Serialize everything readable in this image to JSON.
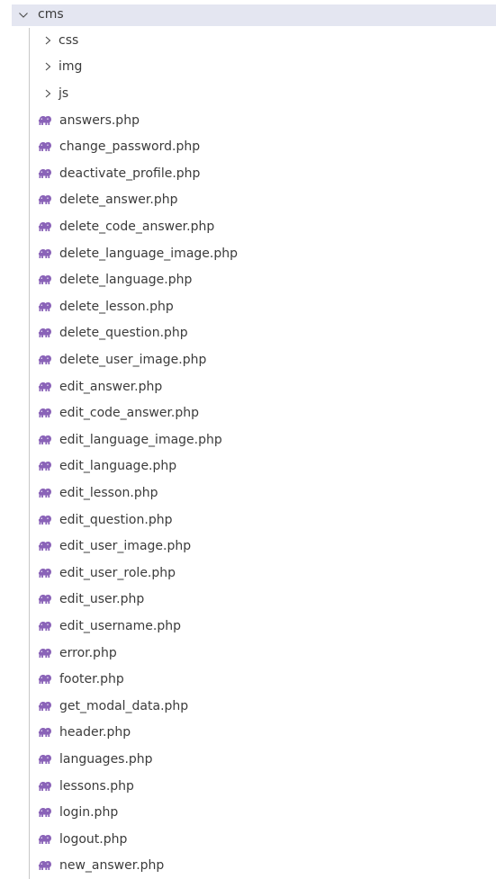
{
  "explorer": {
    "root": {
      "label": "cms",
      "icon": "chevron-down-icon",
      "expanded": true
    },
    "folders": [
      {
        "label": "css",
        "icon": "chevron-right-icon"
      },
      {
        "label": "img",
        "icon": "chevron-right-icon"
      },
      {
        "label": "js",
        "icon": "chevron-right-icon"
      }
    ],
    "files": [
      {
        "label": "answers.php",
        "icon": "php-elephant-icon"
      },
      {
        "label": "change_password.php",
        "icon": "php-elephant-icon"
      },
      {
        "label": "deactivate_profile.php",
        "icon": "php-elephant-icon"
      },
      {
        "label": "delete_answer.php",
        "icon": "php-elephant-icon"
      },
      {
        "label": "delete_code_answer.php",
        "icon": "php-elephant-icon"
      },
      {
        "label": "delete_language_image.php",
        "icon": "php-elephant-icon"
      },
      {
        "label": "delete_language.php",
        "icon": "php-elephant-icon"
      },
      {
        "label": "delete_lesson.php",
        "icon": "php-elephant-icon"
      },
      {
        "label": "delete_question.php",
        "icon": "php-elephant-icon"
      },
      {
        "label": "delete_user_image.php",
        "icon": "php-elephant-icon"
      },
      {
        "label": "edit_answer.php",
        "icon": "php-elephant-icon"
      },
      {
        "label": "edit_code_answer.php",
        "icon": "php-elephant-icon"
      },
      {
        "label": "edit_language_image.php",
        "icon": "php-elephant-icon"
      },
      {
        "label": "edit_language.php",
        "icon": "php-elephant-icon"
      },
      {
        "label": "edit_lesson.php",
        "icon": "php-elephant-icon"
      },
      {
        "label": "edit_question.php",
        "icon": "php-elephant-icon"
      },
      {
        "label": "edit_user_image.php",
        "icon": "php-elephant-icon"
      },
      {
        "label": "edit_user_role.php",
        "icon": "php-elephant-icon"
      },
      {
        "label": "edit_user.php",
        "icon": "php-elephant-icon"
      },
      {
        "label": "edit_username.php",
        "icon": "php-elephant-icon"
      },
      {
        "label": "error.php",
        "icon": "php-elephant-icon"
      },
      {
        "label": "footer.php",
        "icon": "php-elephant-icon"
      },
      {
        "label": "get_modal_data.php",
        "icon": "php-elephant-icon"
      },
      {
        "label": "header.php",
        "icon": "php-elephant-icon"
      },
      {
        "label": "languages.php",
        "icon": "php-elephant-icon"
      },
      {
        "label": "lessons.php",
        "icon": "php-elephant-icon"
      },
      {
        "label": "login.php",
        "icon": "php-elephant-icon"
      },
      {
        "label": "logout.php",
        "icon": "php-elephant-icon"
      },
      {
        "label": "new_answer.php",
        "icon": "php-elephant-icon"
      }
    ],
    "colors": {
      "root_background": "#e4e6f1",
      "text": "#3b3b3b",
      "php_icon": "#8a63b8",
      "indent_guide": "#c8c8c8"
    }
  }
}
